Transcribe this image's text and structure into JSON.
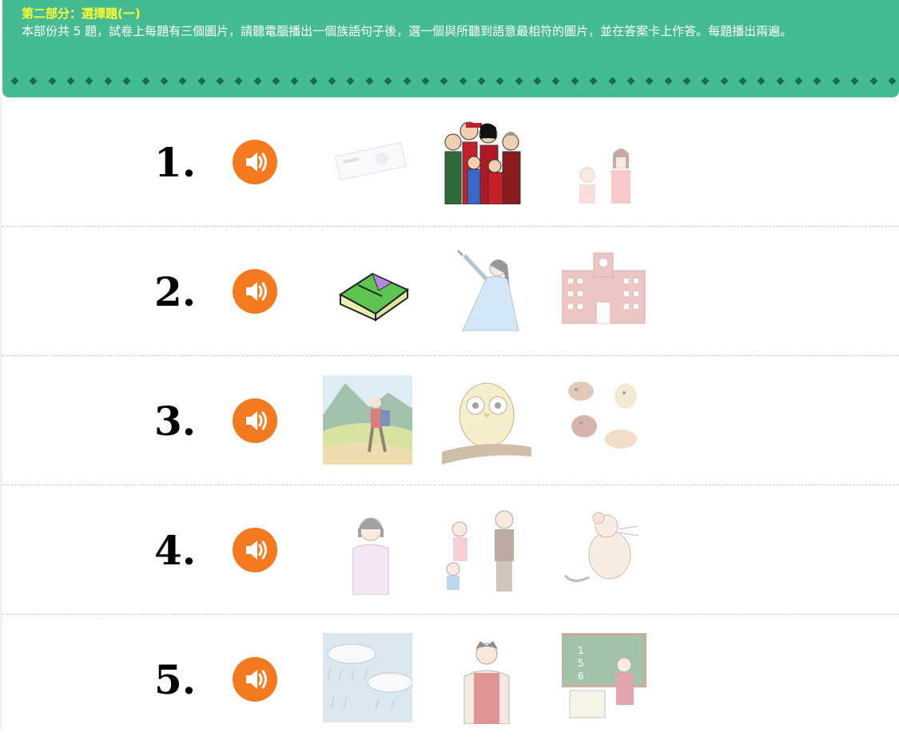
{
  "header": {
    "title": "第二部分：選擇題(一)",
    "description": "本部份共 5 題，試卷上每題有三個圖片，請聽電腦播出一個族語句子後，選一個與所聽到語意最相符的圖片，並在答案卡上作答。每題播出兩遍。"
  },
  "questions": [
    {
      "number": "1.",
      "options": [
        "money-note",
        "family-group",
        "mother-daughter"
      ]
    },
    {
      "number": "2.",
      "options": [
        "eraser-box",
        "dancing-woman",
        "school-building"
      ]
    },
    {
      "number": "3.",
      "options": [
        "hiker-mountain",
        "owl-branch",
        "dogs-group"
      ]
    },
    {
      "number": "4.",
      "options": [
        "woman-student",
        "grandpa-children",
        "mouse"
      ]
    },
    {
      "number": "5.",
      "options": [
        "rain-clouds",
        "man-vest",
        "teacher-blackboard"
      ]
    }
  ],
  "colors": {
    "header_bg": "#45bb92",
    "title_yellow": "#ffff33",
    "speaker_orange": "#f47a20",
    "diamond_dark": "#1d6a4a"
  },
  "icons": {
    "speaker": "speaker-icon"
  }
}
